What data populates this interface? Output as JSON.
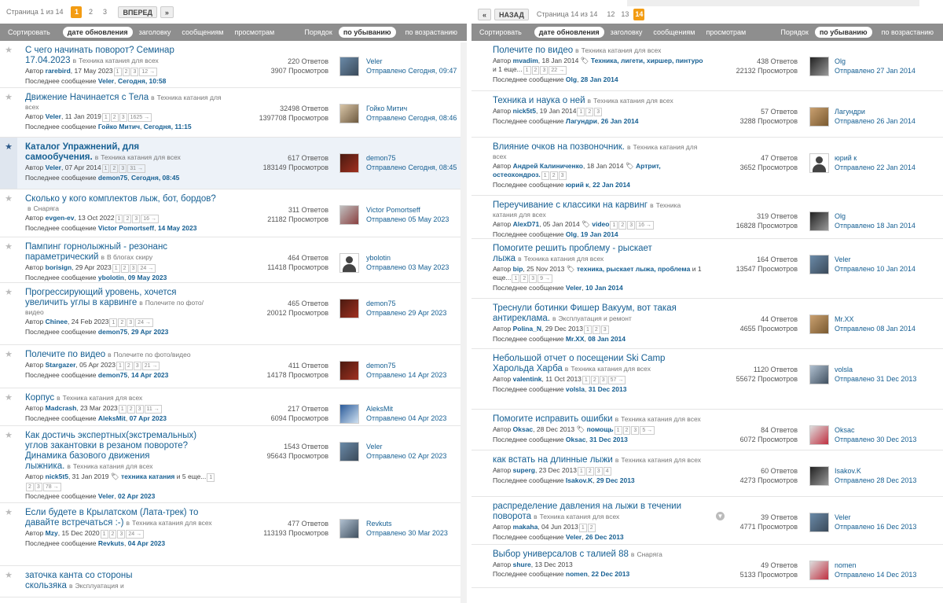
{
  "left": {
    "pager": {
      "status": "Страница 1 из 14",
      "pages": [
        "1",
        "2",
        "3"
      ],
      "next": "ВПЕРЕД",
      "arrow": "»"
    },
    "sort": {
      "label": "Сортировать",
      "opts": [
        "дате обновления",
        "заголовку",
        "сообщениям",
        "просмотрам"
      ],
      "order_label": "Порядок",
      "desc": "по убыванию",
      "asc": "по возрастанию"
    },
    "rows": [
      {
        "title": "С чего начинать поворот? Семинар 17.04.2023",
        "in": "в",
        "forum": "Техника катания для всех",
        "author_label": "Автор",
        "author": "rarebird",
        "date": "17 May 2023",
        "pages": [
          "1",
          "2",
          "3",
          "12 →"
        ],
        "last_label": "Последнее сообщение",
        "last_user": "Veler",
        "last_time": "Сегодня, 10:58",
        "replies": "220 Ответов",
        "views": "3907 Просмотров",
        "poster": "Veler",
        "sent": "Отправлено Сегодня, 09:47"
      },
      {
        "title": "Движение Начинается с Тела",
        "in": "в",
        "forum": "Техника катания для всех",
        "author_label": "Автор",
        "author": "Veler",
        "date": "11 Jan 2019",
        "pages": [
          "1",
          "2",
          "3",
          "1625 →"
        ],
        "last_label": "Последнее сообщение",
        "last_user": "Гойко Митич",
        "last_time": "Сегодня, 11:15",
        "replies": "32498 Ответов",
        "views": "1397708 Просмотров",
        "poster": "Гойко Митич",
        "sent": "Отправлено Сегодня, 08:46"
      },
      {
        "title": "Каталог Упражнений, для самообучения.",
        "in": "в",
        "forum": "Техника катания для всех",
        "author_label": "Автор",
        "author": "Veler",
        "date": "07 Apr 2014",
        "pages": [
          "1",
          "2",
          "3",
          "31 →"
        ],
        "last_label": "Последнее сообщение",
        "last_user": "demon75",
        "last_time": "Сегодня, 08:45",
        "replies": "617 Ответов",
        "views": "183149 Просмотров",
        "poster": "demon75",
        "sent": "Отправлено Сегодня, 08:45"
      },
      {
        "title": "Сколько у кого комплектов лыж, бот, бордов?",
        "in": "в",
        "forum": "Снаряга",
        "author_label": "Автор",
        "author": "evgen-ev",
        "date": "13 Oct 2022",
        "pages": [
          "1",
          "2",
          "3",
          "16 →"
        ],
        "last_label": "Последнее сообщение",
        "last_user": "Victor Pomortseff",
        "last_time": "14 May 2023",
        "replies": "311 Ответов",
        "views": "21182 Просмотров",
        "poster": "Victor Pomortseff",
        "sent": "Отправлено 05 May 2023"
      },
      {
        "title": "Пампинг горнолыжный - резонанс параметрический",
        "in": "в",
        "forum": "В блогах скиру",
        "author_label": "Автор",
        "author": "borisign",
        "date": "29 Apr 2023",
        "pages": [
          "1",
          "2",
          "3",
          "24 →"
        ],
        "last_label": "Последнее сообщение",
        "last_user": "ybolotin",
        "last_time": "09 May 2023",
        "replies": "464 Ответов",
        "views": "11418 Просмотров",
        "poster": "ybolotin",
        "sent": "Отправлено 03 May 2023"
      },
      {
        "title": "Прогрессирующий уровень, хочется увеличить углы в карвинге",
        "in": "в",
        "forum": "Полечите по фото/видео",
        "author_label": "Автор",
        "author": "Chinee",
        "date": "24 Feb 2023",
        "pages": [
          "1",
          "2",
          "3",
          "24 →"
        ],
        "last_label": "Последнее сообщение",
        "last_user": "demon75",
        "last_time": "29 Apr 2023",
        "replies": "465 Ответов",
        "views": "20012 Просмотров",
        "poster": "demon75",
        "sent": "Отправлено 29 Apr 2023"
      },
      {
        "title": "Полечите по видео",
        "in": "в",
        "forum": "Полечите по фото/видео",
        "author_label": "Автор",
        "author": "Stargazer",
        "date": "05 Apr 2023",
        "pages": [
          "1",
          "2",
          "3",
          "21 →"
        ],
        "last_label": "Последнее сообщение",
        "last_user": "demon75",
        "last_time": "14 Apr 2023",
        "replies": "411 Ответов",
        "views": "14178 Просмотров",
        "poster": "demon75",
        "sent": "Отправлено 14 Apr 2023"
      },
      {
        "title": "Корпус",
        "in": "в",
        "forum": "Техника катания для всех",
        "author_label": "Автор",
        "author": "Madcrash",
        "date": "23 Mar 2023",
        "pages": [
          "1",
          "2",
          "3",
          "11 →"
        ],
        "last_label": "Последнее сообщение",
        "last_user": "AleksMit",
        "last_time": "07 Apr 2023",
        "replies": "217 Ответов",
        "views": "6094 Просмотров",
        "poster": "AleksMit",
        "sent": "Отправлено 04 Apr 2023"
      },
      {
        "title": "Как достичь экспертных(экстремальных) углов закантовки в резаном повороте? Динамика базового движения лыжника.",
        "in": "в",
        "forum": "Техника катания для всех",
        "author_label": "Автор",
        "author": "nick5t5",
        "date": "31 Jan 2019",
        "tags": "техника катания",
        "tags_more": "и 5 еще...",
        "pages": [
          "1",
          "2",
          "3",
          "78 →"
        ],
        "last_label": "Последнее сообщение",
        "last_user": "Veler",
        "last_time": "02 Apr 2023",
        "replies": "1543 Ответов",
        "views": "95643 Просмотров",
        "poster": "Veler",
        "sent": "Отправлено 02 Apr 2023"
      },
      {
        "title": "Если будете в Крылатском (Лата-трек) то давайте встречаться :-)",
        "in": "в",
        "forum": "Техника катания для всех",
        "author_label": "Автор",
        "author": "Mzy",
        "date": "15 Dec 2020",
        "pages": [
          "1",
          "2",
          "3",
          "24 →"
        ],
        "last_label": "Последнее сообщение",
        "last_user": "Revkuts",
        "last_time": "04 Apr 2023",
        "replies": "477 Ответов",
        "views": "113193 Просмотров",
        "poster": "Revkuts",
        "sent": "Отправлено 30 Mar 2023"
      },
      {
        "title": "заточка канта со стороны скользяка",
        "in": "в",
        "forum": "Эксплуатация и",
        "replies": "",
        "views": ""
      }
    ]
  },
  "right": {
    "pager": {
      "back_arrow": "«",
      "back": "НАЗАД",
      "status": "Страница 14 из 14",
      "pages": [
        "12",
        "13",
        "14"
      ]
    },
    "sort": {
      "label": "Сортировать",
      "opts": [
        "дате обновления",
        "заголовку",
        "сообщениям",
        "просмотрам"
      ],
      "order_label": "Порядок",
      "desc": "по убыванию",
      "asc": "по возрастанию"
    },
    "rows": [
      {
        "title": "Полечите по видео",
        "in": "в",
        "forum": "Техника катания для всех",
        "author_label": "Автор",
        "author": "mvadim",
        "date": "18 Jan 2014",
        "tags": "Техника, лигети, хиршер, пинтуро",
        "tags_more": "и 1 еще...",
        "pages": [
          "1",
          "2",
          "3",
          "22 →"
        ],
        "last_label": "Последнее сообщение",
        "last_user": "Olg",
        "last_time": "28 Jan 2014",
        "replies": "438 Ответов",
        "views": "22132 Просмотров",
        "poster": "Olg",
        "sent": "Отправлено 27 Jan 2014"
      },
      {
        "title": "Техника и наука о ней",
        "in": "в",
        "forum": "Техника катания для всех",
        "author_label": "Автор",
        "author": "nick5t5",
        "date": "19 Jan 2014",
        "pages": [
          "1",
          "2",
          "3"
        ],
        "last_label": "Последнее сообщение",
        "last_user": "Лагундри",
        "last_time": "26 Jan 2014",
        "replies": "57 Ответов",
        "views": "3288 Просмотров",
        "poster": "Лагундри",
        "sent": "Отправлено 26 Jan 2014"
      },
      {
        "title": "Влияние очков на позвоночник.",
        "in": "в",
        "forum": "Техника катания для всех",
        "author_label": "Автор",
        "author": "Андрей Калиниченко",
        "date": "18 Jan 2014",
        "tags": "Артрит, остеохондроз.",
        "pages": [
          "1",
          "2",
          "3"
        ],
        "last_label": "Последнее сообщение",
        "last_user": "юрий к",
        "last_time": "22 Jan 2014",
        "replies": "47 Ответов",
        "views": "3652 Просмотров",
        "poster": "юрий к",
        "sent": "Отправлено 22 Jan 2014"
      },
      {
        "title": "Переучивание с классики на карвинг",
        "in": "в",
        "forum": "Техника катания для всех",
        "author_label": "Автор",
        "author": "AlexD71",
        "date": "05 Jan 2014",
        "tags": "video",
        "pages": [
          "1",
          "2",
          "3",
          "16 →"
        ],
        "last_label": "Последнее сообщение",
        "last_user": "Olg",
        "last_time": "19 Jan 2014",
        "replies": "319 Ответов",
        "views": "16828 Просмотров",
        "poster": "Olg",
        "sent": "Отправлено 18 Jan 2014"
      },
      {
        "title": "Помогите решить проблему - рыскает лыжа",
        "in": "в",
        "forum": "Техника катания для всех",
        "author_label": "Автор",
        "author": "bip",
        "date": "25 Nov 2013",
        "tags": "техника, рыскает лыжа, проблема",
        "tags_more": "и 1 еще...",
        "pages": [
          "1",
          "2",
          "3",
          "9 →"
        ],
        "last_label": "Последнее сообщение",
        "last_user": "Veler",
        "last_time": "10 Jan 2014",
        "replies": "164 Ответов",
        "views": "13547 Просмотров",
        "poster": "Veler",
        "sent": "Отправлено 10 Jan 2014"
      },
      {
        "title": "Треснули ботинки Фишер Вакуум, вот такая антиреклама.",
        "in": "в",
        "forum": "Эксплуатация и ремонт",
        "author_label": "Автор",
        "author": "Polina_N",
        "date": "29 Dec 2013",
        "pages": [
          "1",
          "2",
          "3"
        ],
        "last_label": "Последнее сообщение",
        "last_user": "Mr.XX",
        "last_time": "08 Jan 2014",
        "replies": "44 Ответов",
        "views": "4655 Просмотров",
        "poster": "Mr.XX",
        "sent": "Отправлено 08 Jan 2014"
      },
      {
        "title": "Небольшой отчет о посещении Ski Camp Харольда Харба",
        "in": "в",
        "forum": "Техника катания для всех",
        "author_label": "Автор",
        "author": "valentink",
        "date": "11 Oct 2013",
        "pages": [
          "1",
          "2",
          "3",
          "57 →"
        ],
        "last_label": "Последнее сообщение",
        "last_user": "volsla",
        "last_time": "31 Dec 2013",
        "replies": "1120 Ответов",
        "views": "55672 Просмотров",
        "poster": "volsla",
        "sent": "Отправлено 31 Dec 2013"
      },
      {
        "title": "Помогите исправить ошибки",
        "in": "в",
        "forum": "Техника катания для всех",
        "author_label": "Автор",
        "author": "Oksac",
        "date": "28 Dec 2013",
        "tags": "помощь",
        "pages": [
          "1",
          "2",
          "3",
          "5 →"
        ],
        "last_label": "Последнее сообщение",
        "last_user": "Oksac",
        "last_time": "31 Dec 2013",
        "replies": "84 Ответов",
        "views": "6072 Просмотров",
        "poster": "Oksac",
        "sent": "Отправлено 30 Dec 2013"
      },
      {
        "title": "как встать на длинные лыжи",
        "in": "в",
        "forum": "Техника катания для всех",
        "author_label": "Автор",
        "author": "superg",
        "date": "23 Dec 2013",
        "pages": [
          "1",
          "2",
          "3",
          "4"
        ],
        "last_label": "Последнее сообщение",
        "last_user": "Isakov.K",
        "last_time": "29 Dec 2013",
        "replies": "60 Ответов",
        "views": "4273 Просмотров",
        "poster": "Isakov.K",
        "sent": "Отправлено 28 Dec 2013"
      },
      {
        "title": "распределение давления на лыжи в течении поворота",
        "in": "в",
        "forum": "Техника катания для всех",
        "author_label": "Автор",
        "author": "makaha",
        "date": "04 Jun 2013",
        "pages": [
          "1",
          "2"
        ],
        "last_label": "Последнее сообщение",
        "last_user": "Veler",
        "last_time": "26 Dec 2013",
        "replies": "39 Ответов",
        "views": "4771 Просмотров",
        "poster": "Veler",
        "sent": "Отправлено 16 Dec 2013"
      },
      {
        "title": "Выбор универсалов с талией 88",
        "in": "в",
        "forum": "Снаряга",
        "author_label": "Автор",
        "author": "shure",
        "date": "13 Dec 2013",
        "pages": [],
        "last_label": "Последнее сообщение",
        "last_user": "nomen",
        "last_time": "22 Dec 2013",
        "replies": "49 Ответов",
        "views": "5133 Просмотров",
        "poster": "nomen",
        "sent": "Отправлено 14 Dec 2013"
      }
    ]
  }
}
